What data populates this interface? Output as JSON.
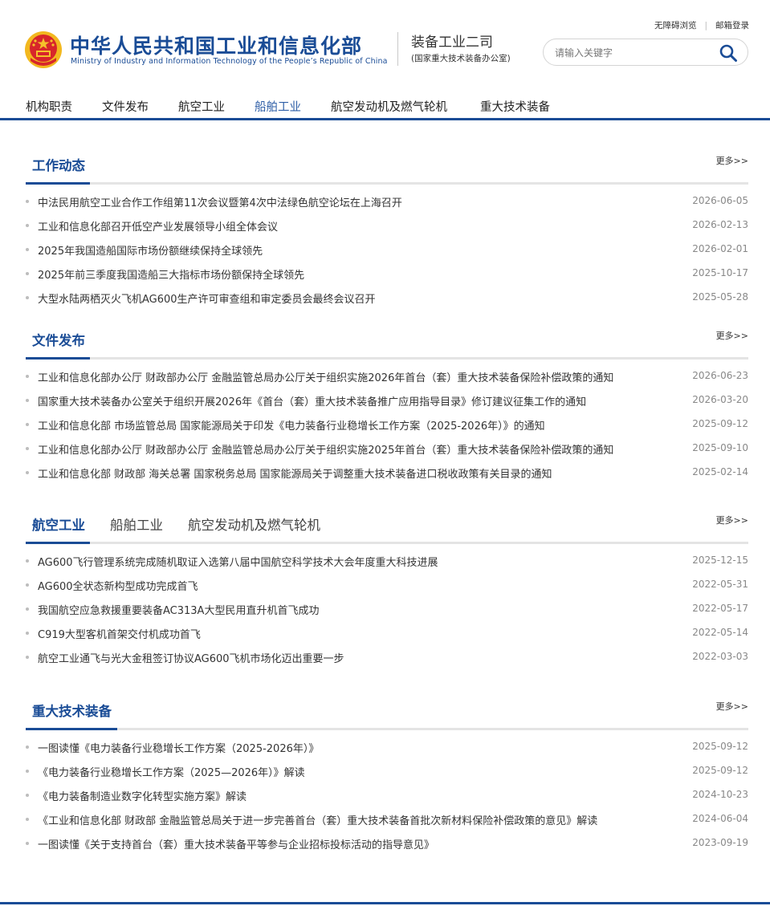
{
  "header": {
    "ministry_cn": "中华人民共和国工业和信息化部",
    "ministry_en": "Ministry of Industry and Information Technology of the People’s Republic of China",
    "dept_name": "装备工业二司",
    "dept_sub": "(国家重大技术装备办公室)",
    "top_links": [
      "无障碍浏览",
      "邮箱登录"
    ],
    "search_placeholder": "请输入关键字"
  },
  "nav": {
    "items": [
      "机构职责",
      "文件发布",
      "航空工业",
      "船舶工业",
      "航空发动机及燃气轮机",
      "重大技术装备"
    ],
    "active_index": 3
  },
  "sections": [
    {
      "title": "工作动态",
      "more": "更多>>",
      "items": [
        {
          "title": "中法民用航空工业合作工作组第11次会议暨第4次中法绿色航空论坛在上海召开",
          "date": "2026-06-05"
        },
        {
          "title": "工业和信息化部召开低空产业发展领导小组全体会议",
          "date": "2026-02-13"
        },
        {
          "title": "2025年我国造船国际市场份额继续保持全球领先",
          "date": "2026-02-01"
        },
        {
          "title": "2025年前三季度我国造船三大指标市场份额保持全球领先",
          "date": "2025-10-17"
        },
        {
          "title": "大型水陆两栖灭火飞机AG600生产许可审查组和审定委员会最终会议召开",
          "date": "2025-05-28"
        }
      ]
    },
    {
      "title": "文件发布",
      "more": "更多>>",
      "items": [
        {
          "title": "工业和信息化部办公厅 财政部办公厅 金融监管总局办公厅关于组织实施2026年首台（套）重大技术装备保险补偿政策的通知",
          "date": "2026-06-23"
        },
        {
          "title": "国家重大技术装备办公室关于组织开展2026年《首台（套）重大技术装备推广应用指导目录》修订建议征集工作的通知",
          "date": "2026-03-20"
        },
        {
          "title": "工业和信息化部 市场监管总局 国家能源局关于印发《电力装备行业稳增长工作方案（2025-2026年）》的通知",
          "date": "2025-09-12"
        },
        {
          "title": "工业和信息化部办公厅 财政部办公厅 金融监管总局办公厅关于组织实施2025年首台（套）重大技术装备保险补偿政策的通知",
          "date": "2025-09-10"
        },
        {
          "title": "工业和信息化部 财政部 海关总署 国家税务总局 国家能源局关于调整重大技术装备进口税收政策有关目录的通知",
          "date": "2025-02-14"
        }
      ]
    },
    {
      "tabs": [
        "航空工业",
        "船舶工业",
        "航空发动机及燃气轮机"
      ],
      "active_tab": 0,
      "more": "更多>>",
      "items": [
        {
          "title": "AG600飞行管理系统完成随机取证入选第八届中国航空科学技术大会年度重大科技进展",
          "date": "2025-12-15"
        },
        {
          "title": "AG600全状态新构型成功完成首飞",
          "date": "2022-05-31"
        },
        {
          "title": "我国航空应急救援重要装备AC313A大型民用直升机首飞成功",
          "date": "2022-05-17"
        },
        {
          "title": "C919大型客机首架交付机成功首飞",
          "date": "2022-05-14"
        },
        {
          "title": "航空工业通飞与光大金租签订协议AG600飞机市场化迈出重要一步",
          "date": "2022-03-03"
        }
      ]
    },
    {
      "title": "重大技术装备",
      "more": "更多>>",
      "items": [
        {
          "title": "一图读懂《电力装备行业稳增长工作方案（2025-2026年）》",
          "date": "2025-09-12"
        },
        {
          "title": "《电力装备行业稳增长工作方案（2025—2026年）》解读",
          "date": "2025-09-12"
        },
        {
          "title": "《电力装备制造业数字化转型实施方案》解读",
          "date": "2024-10-23"
        },
        {
          "title": "《工业和信息化部 财政部 金融监管总局关于进一步完善首台（套）重大技术装备首批次新材料保险补偿政策的意见》解读",
          "date": "2024-06-04"
        },
        {
          "title": "一图读懂《关于支持首台（套）重大技术装备平等参与企业招标投标活动的指导意见》",
          "date": "2023-09-19"
        }
      ]
    }
  ],
  "colors": {
    "brand_blue": "#1a4c96",
    "nav_active": "#2f5fa7",
    "emblem_red": "#d7262b",
    "emblem_gold": "#f5c12b"
  }
}
